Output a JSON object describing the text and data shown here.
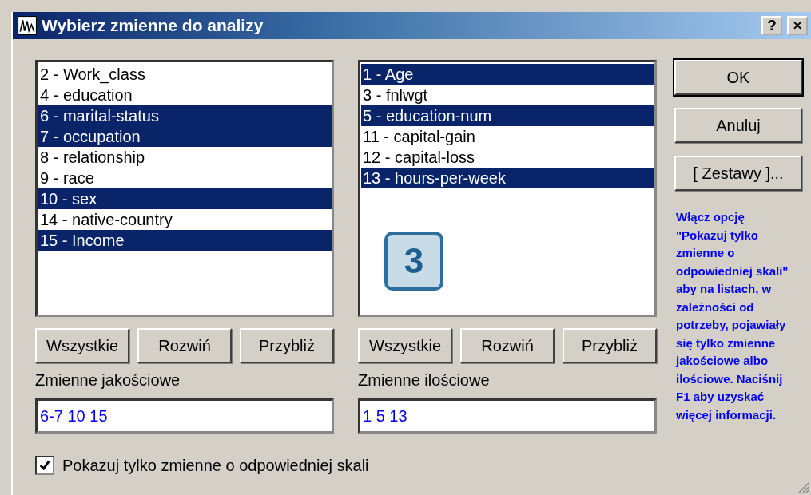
{
  "window": {
    "title": "Wybierz zmienne do analizy",
    "help_button": "?",
    "close_button": "×"
  },
  "lists": [
    {
      "items": [
        {
          "label": "2 - Work_class",
          "selected": false
        },
        {
          "label": "4 - education",
          "selected": false
        },
        {
          "label": "6 - marital-status",
          "selected": true
        },
        {
          "label": "7 - occupation",
          "selected": true
        },
        {
          "label": "8 - relationship",
          "selected": false
        },
        {
          "label": "9 - race",
          "selected": false
        },
        {
          "label": "10 - sex",
          "selected": true
        },
        {
          "label": "14 - native-country",
          "selected": false
        },
        {
          "label": "15 - Income",
          "selected": true
        }
      ],
      "buttons": [
        "Wszystkie",
        "Rozwiń",
        "Przybliż"
      ],
      "field_label": "Zmienne jakościowe",
      "field_value": "6-7 10 15"
    },
    {
      "items": [
        {
          "label": "1 - Age",
          "selected": true
        },
        {
          "label": "3 - fnlwgt",
          "selected": false
        },
        {
          "label": "5 - education-num",
          "selected": true
        },
        {
          "label": "11 - capital-gain",
          "selected": false
        },
        {
          "label": "12 - capital-loss",
          "selected": false
        },
        {
          "label": "13 - hours-per-week",
          "selected": true
        }
      ],
      "buttons": [
        "Wszystkie",
        "Rozwiń",
        "Przybliż"
      ],
      "field_label": "Zmienne ilościowe",
      "field_value": "1 5 13"
    }
  ],
  "side_buttons": [
    "OK",
    "Anuluj",
    "[ Zestawy ]..."
  ],
  "help_text": "Włącz opcję \"Pokazuj tylko zmienne o odpowiedniej skali\" aby na listach, w zależności od potrzeby, pojawiały się tylko zmienne jakościowe albo ilościowe. Naciśnij F1 aby uzyskać więcej informacji.",
  "checkbox": {
    "label": "Pokazuj tylko zmienne o odpowiedniej skali",
    "checked": true
  },
  "badge": "3"
}
